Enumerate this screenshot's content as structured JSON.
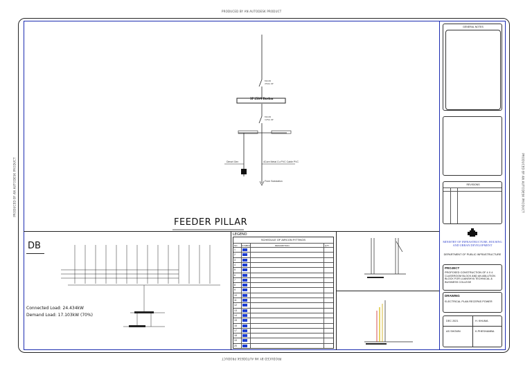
{
  "stamps": {
    "top": "PRODUCED BY AN AUTODESK PRODUCT",
    "bottom": "PRODUCED BY AN AUTODESK PRODUCT",
    "left": "PRODUCED BY AN AUTODESK PRODUCT",
    "right": "PRODUCED BY AN AUTODESK PRODUCT"
  },
  "feeder": {
    "title": "FEEDER PILLAR",
    "busbar_label": "3P 250A Busbar",
    "right_feed_label": "4Core Metal Cu PVC Cable PVC",
    "left_feed_label": "Diesel Gen",
    "from_sub": "From Substation"
  },
  "db": {
    "title": "DB",
    "connected_load": "Connected Load: 24.434kW",
    "demand_load": "Demand Load: 17.103kW (70%)"
  },
  "legend": {
    "heading": "LEGEND",
    "schedule": "SCHEDULE OF AIRCON FITTINGS",
    "cols": [
      "NO",
      "SYMBOL",
      "DESCRIPTION",
      "QTY"
    ],
    "row_numbers": [
      "1",
      "2",
      "3",
      "4",
      "5",
      "6",
      "7",
      "8",
      "9",
      "10",
      "11",
      "12",
      "13",
      "14",
      "15",
      "16",
      "17",
      "18",
      "19",
      "20"
    ]
  },
  "title_block": {
    "general_notes": "GENERAL NOTES",
    "revisions": "REVISIONS",
    "ministry": "MINISTRY OF INFRASTRUCTURE, HOUSING AND URBAN DEVELOPMENT",
    "department": "DEPARTMENT OF PUBLIC INFRASTRUCTURE",
    "project_label": "PROJECT",
    "project_text": "PROPOSED CONSTRUCTION OF 4 X 4 CLASSROOM BLOCK AND AN ABLUTION BLOCK FOR LUANSHYA TECHNICAL & BUSINESS COLLEGE",
    "drawing_label": "DRAWING",
    "drawing_text": "ELECTRICAL PLAN RECEPAS POWER",
    "date": "DEC 2021",
    "scale": "AS SHOWN",
    "drawn_by": "H. KHUMA",
    "checked_by": "K.PHESHAMBA"
  },
  "colors": {
    "frame_blue": "#1a2bb0",
    "ministry_blue": "#3344cc"
  }
}
